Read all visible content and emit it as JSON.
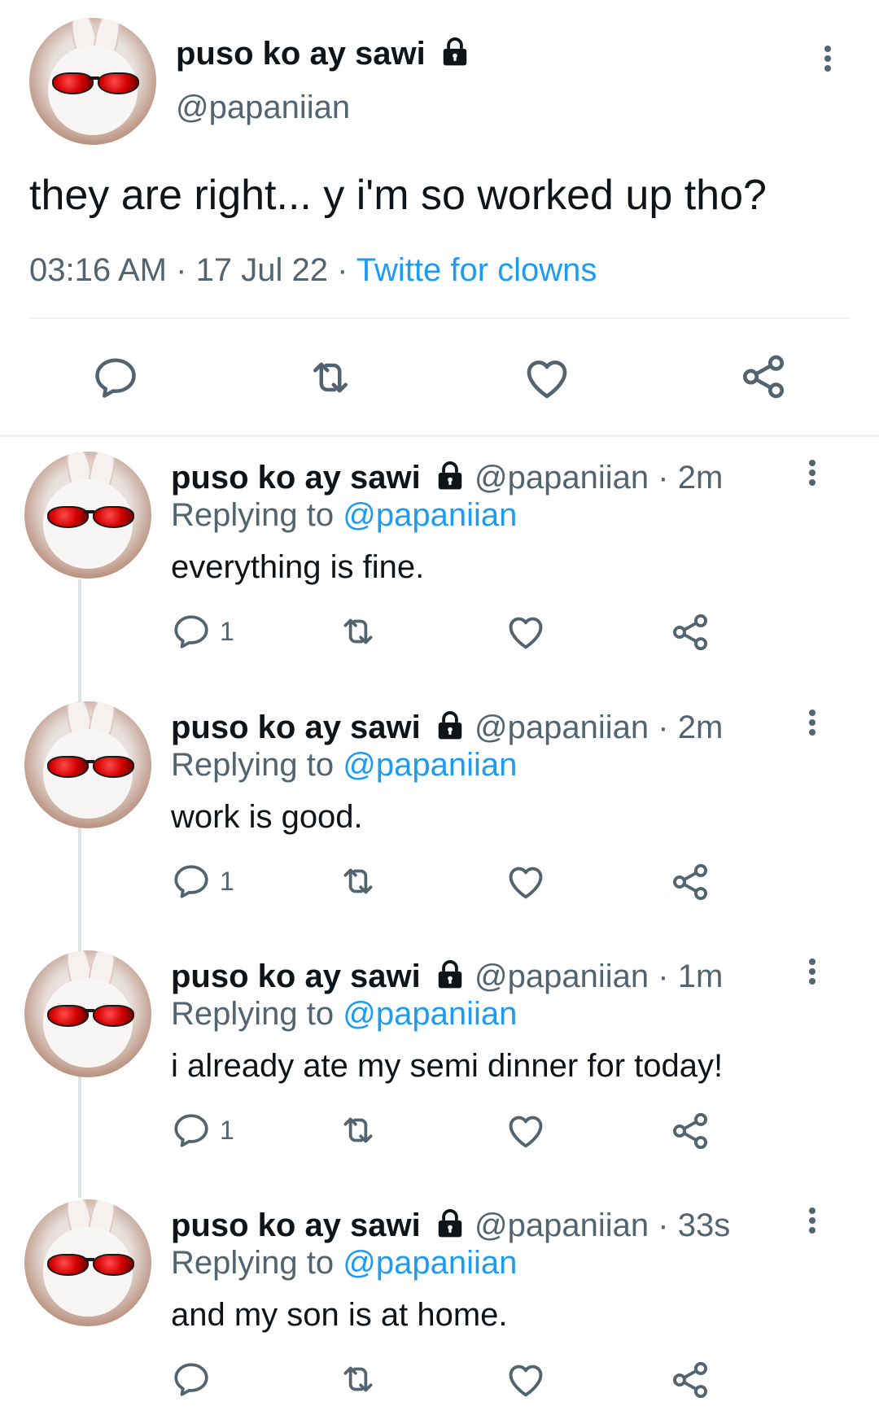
{
  "main_tweet": {
    "display_name": "puso ko ay sawi",
    "handle": "@papaniian",
    "text": "they are right... y i'm so worked up tho?",
    "time": "03:16 AM",
    "date": "17 Jul 22",
    "separator": "·",
    "client": "Twitte for clowns"
  },
  "replies": [
    {
      "display_name": "puso ko ay sawi",
      "handle": "@papaniian",
      "age": "2m",
      "replying_label": "Replying to",
      "replying_handle": "@papaniian",
      "text": "everything is fine.",
      "reply_count": "1"
    },
    {
      "display_name": "puso ko ay sawi",
      "handle": "@papaniian",
      "age": "2m",
      "replying_label": "Replying to",
      "replying_handle": "@papaniian",
      "text": "work is good.",
      "reply_count": "1"
    },
    {
      "display_name": "puso ko ay sawi",
      "handle": "@papaniian",
      "age": "1m",
      "replying_label": "Replying to",
      "replying_handle": "@papaniian",
      "text": "i already ate my semi dinner for today!",
      "reply_count": "1"
    },
    {
      "display_name": "puso ko ay sawi",
      "handle": "@papaniian",
      "age": "33s",
      "replying_label": "Replying to",
      "replying_handle": "@papaniian",
      "text": "and my son is at home.",
      "reply_count": ""
    }
  ],
  "colors": {
    "text": "#0f1419",
    "muted": "#536471",
    "link": "#1d9bf0",
    "divider": "#eff3f4"
  },
  "icons": [
    "lock-icon",
    "more-vertical-icon",
    "reply-icon",
    "retweet-icon",
    "heart-icon",
    "share-icon"
  ]
}
